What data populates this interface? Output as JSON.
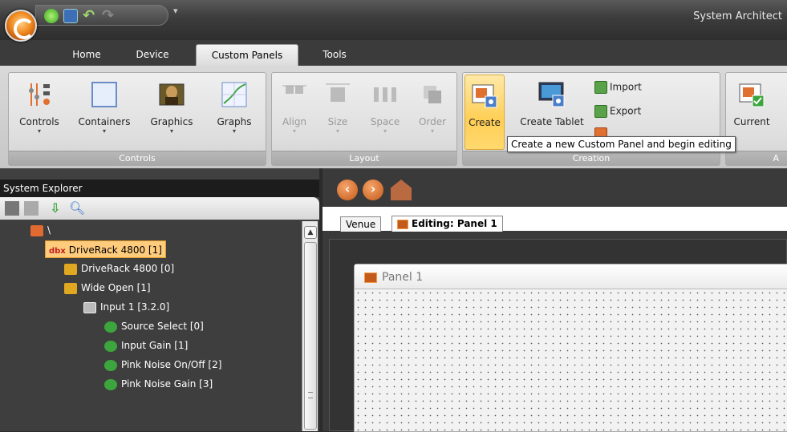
{
  "app": {
    "title": "System Architect"
  },
  "ribbon_tabs": [
    "Home",
    "Device",
    "Custom Panels",
    "Tools"
  ],
  "active_tab": "Custom Panels",
  "groups": {
    "controls": {
      "label": "Controls",
      "buttons": [
        "Controls",
        "Containers",
        "Graphics",
        "Graphs"
      ]
    },
    "layout": {
      "label": "Layout",
      "buttons": [
        "Align",
        "Size",
        "Space",
        "Order"
      ]
    },
    "creation": {
      "label": "Creation",
      "buttons": [
        "Create",
        "Create Tablet"
      ],
      "small": [
        "Import",
        "Export"
      ]
    },
    "active": {
      "label": "A",
      "buttons": [
        "Current"
      ]
    }
  },
  "tooltip": "Create a new Custom Panel and begin editing",
  "explorer": {
    "title": "System Explorer",
    "tree": [
      {
        "label": "\\"
      },
      {
        "label": "DriveRack 4800 [1]",
        "badge": "dbx"
      },
      {
        "label": "DriveRack 4800 [0]"
      },
      {
        "label": "Wide Open [1]"
      },
      {
        "label": "Input 1 [3.2.0]"
      },
      {
        "label": "Source Select [0]"
      },
      {
        "label": "Input Gain [1]"
      },
      {
        "label": "Pink Noise On/Off [2]"
      },
      {
        "label": "Pink Noise Gain [3]"
      }
    ]
  },
  "doc_tabs": [
    "Venue",
    "Editing: Panel 1"
  ],
  "panel": {
    "title": "Panel 1"
  },
  "colors": {
    "accent": "#f08a20",
    "selection": "#ffcb7c",
    "hover": "#ffcf55"
  }
}
